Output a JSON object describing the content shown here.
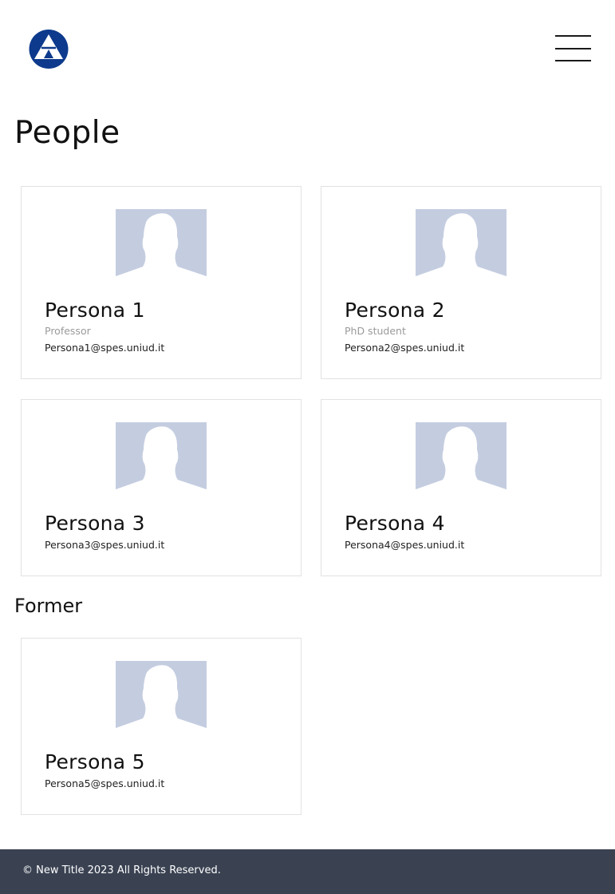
{
  "header": {
    "logo_icon": "triangle-logo-icon",
    "menu_icon": "hamburger-menu-icon"
  },
  "page": {
    "title": "People",
    "former_title": "Former"
  },
  "people": [
    {
      "name": "Persona 1",
      "role": "Professor",
      "email": "Persona1@spes.uniud.it"
    },
    {
      "name": "Persona 2",
      "role": "PhD student",
      "email": "Persona2@spes.uniud.it"
    },
    {
      "name": "Persona 3",
      "role": "",
      "email": "Persona3@spes.uniud.it"
    },
    {
      "name": "Persona 4",
      "role": "",
      "email": "Persona4@spes.uniud.it"
    }
  ],
  "former": [
    {
      "name": "Persona 5",
      "role": "",
      "email": "Persona5@spes.uniud.it"
    }
  ],
  "footer": {
    "text": "© New Title 2023 All Rights Reserved."
  },
  "colors": {
    "logo": "#0d3a8c",
    "avatar_bg": "#c4cde0",
    "footer_bg": "#3a4252"
  }
}
